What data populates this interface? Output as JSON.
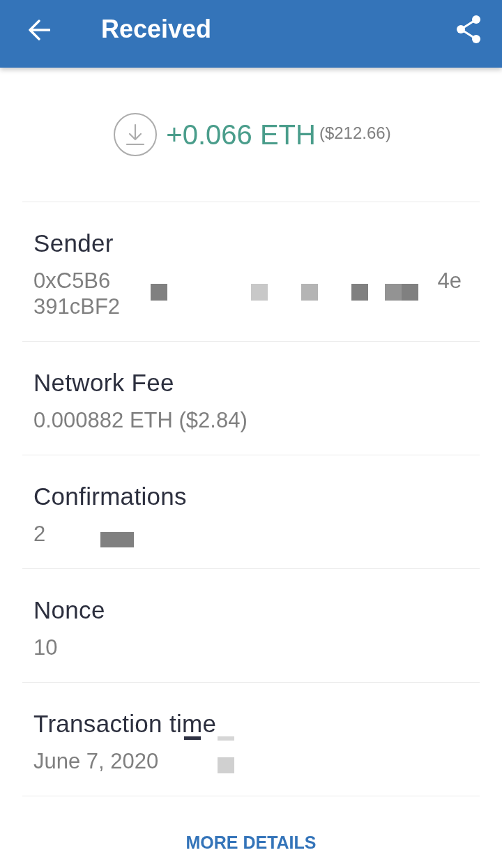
{
  "app_bar": {
    "title": "Received"
  },
  "amount": {
    "value": "+0.066 ETH",
    "fiat": "($212.66)"
  },
  "fields": [
    {
      "label": "Sender",
      "redacted": true,
      "value_lines": [
        {
          "text": "0xC5B6",
          "end": "4e"
        },
        {
          "text": "391cBF2"
        }
      ]
    },
    {
      "label": "Network Fee",
      "redacted": false,
      "value_lines": [
        {
          "text": "0.000882 ETH ($2.84)"
        }
      ]
    },
    {
      "label": "Confirmations",
      "redacted": true,
      "value_lines": [
        {
          "text": "2"
        }
      ]
    },
    {
      "label": "Nonce",
      "redacted": false,
      "value_lines": [
        {
          "text": "10"
        }
      ]
    },
    {
      "label": "Transaction time",
      "redacted": true,
      "value_lines": [
        {
          "text": "June 7, 2020"
        }
      ]
    }
  ],
  "more_details": {
    "label": "MORE DETAILS"
  }
}
